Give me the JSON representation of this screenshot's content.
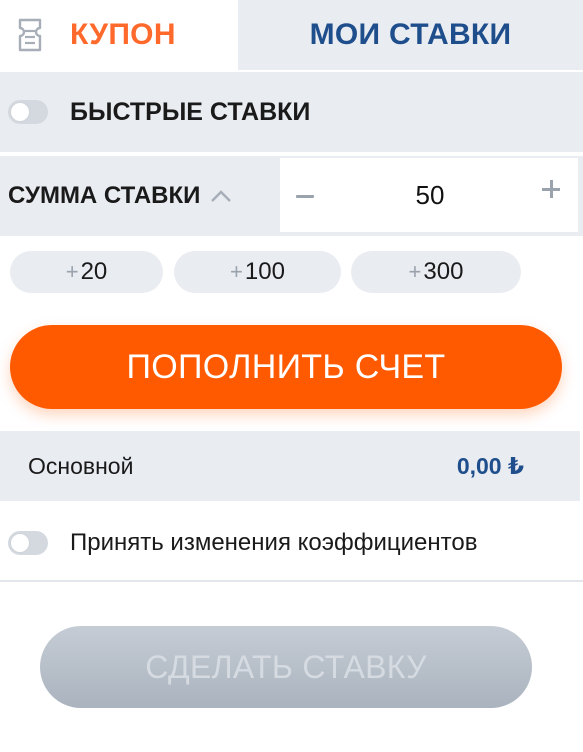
{
  "tabs": {
    "coupon_label": "КУПОН",
    "my_bets_label": "МОИ СТАВКИ",
    "active": "coupon"
  },
  "quick_bets": {
    "label": "БЫСТРЫЕ СТАВКИ",
    "enabled": false
  },
  "stake": {
    "label": "СУММА СТАВКИ",
    "value": "50"
  },
  "quick_add": [
    {
      "prefix": "+",
      "amount": "20"
    },
    {
      "prefix": "+",
      "amount": "100"
    },
    {
      "prefix": "+",
      "amount": "300"
    }
  ],
  "deposit_button": "ПОПОЛНИТЬ СЧЕТ",
  "balance": {
    "label": "Основной",
    "value": "0,00 ₺"
  },
  "accept_changes": {
    "label": "Принять изменения коэффициентов",
    "enabled": false
  },
  "place_bet_button": "СДЕЛАТЬ СТАВКУ",
  "colors": {
    "accent": "#ff5a00",
    "tab_active_text": "#ff6a2c",
    "tab_inactive_text": "#1f4e8c",
    "balance_value": "#1f4e8c",
    "panel_bg": "#e9ecf1",
    "disabled_button": "#b8c0ca"
  },
  "icons": {
    "coupon": "ticket-icon",
    "stake_toggle": "chevron-up-icon",
    "minus": "minus-icon",
    "plus": "plus-icon"
  }
}
